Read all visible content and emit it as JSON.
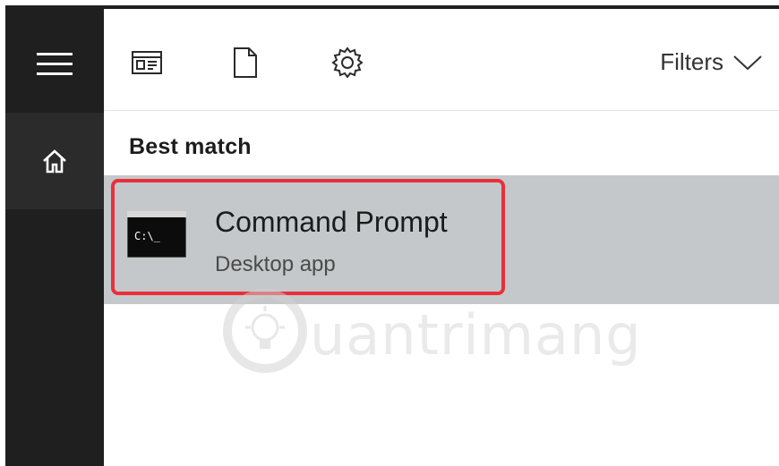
{
  "sidebar": {
    "menu_icon": "hamburger-menu-icon",
    "home_icon": "home-icon"
  },
  "toolbar": {
    "icons": [
      "apps-icon",
      "documents-icon",
      "settings-gear-icon"
    ],
    "filters_label": "Filters",
    "filters_icon": "chevron-down-icon"
  },
  "results": {
    "section_label": "Best match",
    "best_match": {
      "title": "Command Prompt",
      "subtitle": "Desktop app",
      "icon": "command-prompt-icon",
      "icon_text": "C:\\_"
    }
  },
  "watermark": {
    "text": "uantrimang",
    "icon": "lightbulb-logo-icon"
  },
  "colors": {
    "rail": "#1f1f1f",
    "rail_active": "#2b2b2b",
    "selected_row": "#c4c8ca",
    "highlight_border": "#e8303a"
  }
}
